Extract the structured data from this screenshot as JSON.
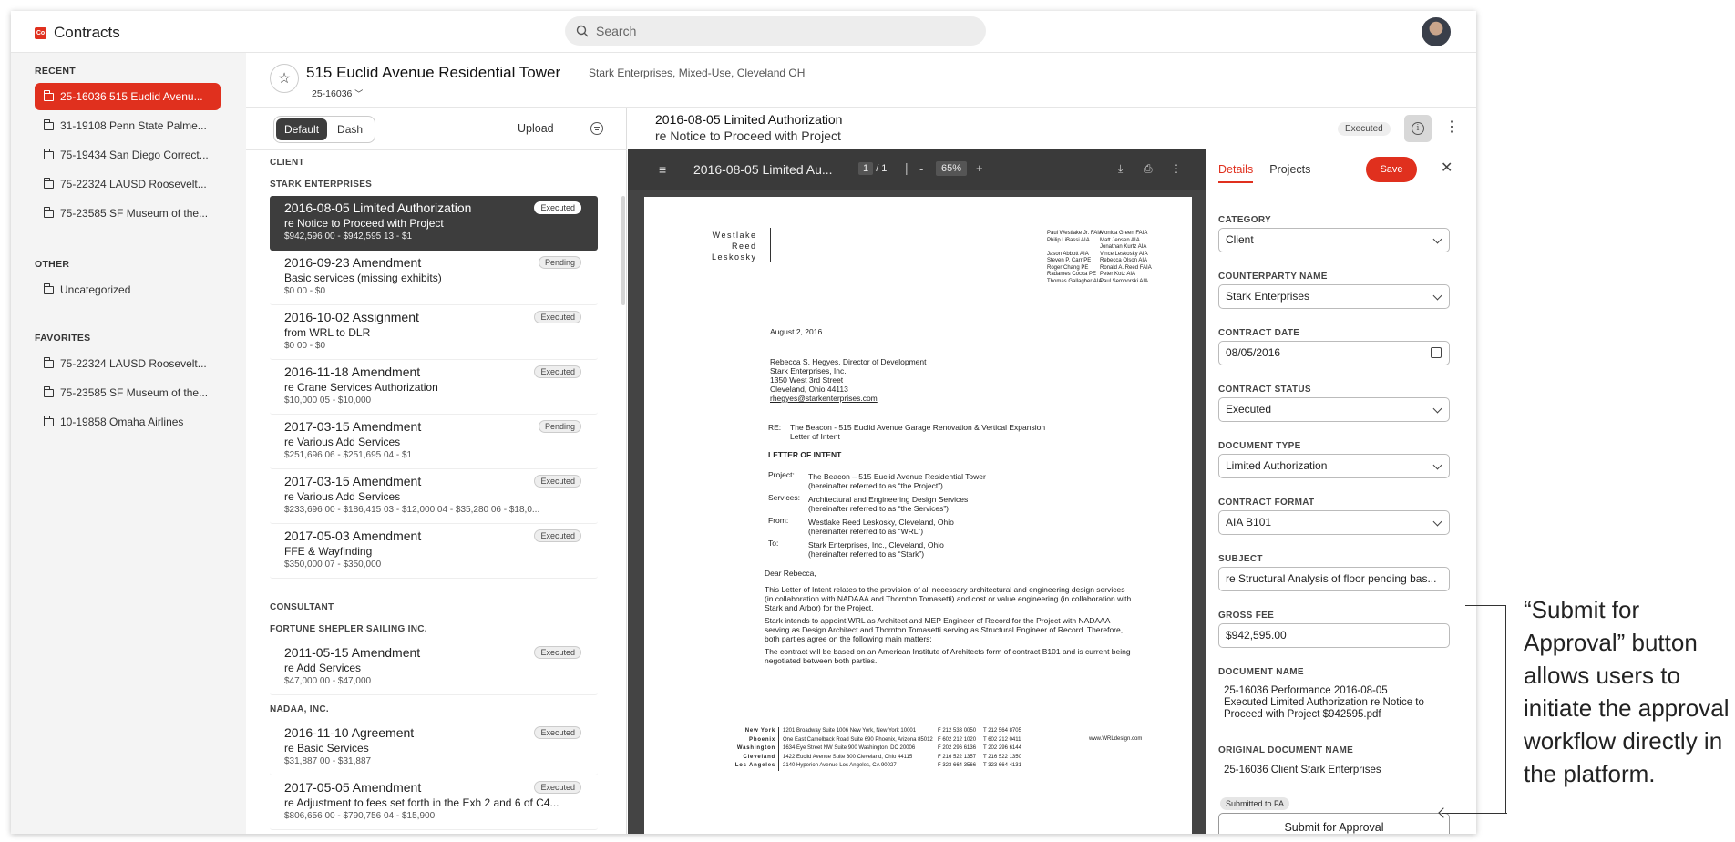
{
  "app": {
    "name": "Contracts",
    "logo_text": "Co"
  },
  "search": {
    "placeholder": "Search"
  },
  "sidebar": {
    "recent_label": "RECENT",
    "recent": [
      {
        "label": "25-16036  515 Euclid Avenu...",
        "active": true
      },
      {
        "label": "31-19108  Penn State Palme..."
      },
      {
        "label": "75-19434  San Diego Correct..."
      },
      {
        "label": "75-22324  LAUSD Roosevelt..."
      },
      {
        "label": "75-23585  SF Museum of the..."
      }
    ],
    "other_label": "OTHER",
    "other": [
      {
        "label": "Uncategorized"
      }
    ],
    "favorites_label": "FAVORITES",
    "favorites": [
      {
        "label": "75-22324  LAUSD Roosevelt..."
      },
      {
        "label": "75-23585  SF Museum of the..."
      },
      {
        "label": "10-19858  Omaha Airlines"
      }
    ]
  },
  "project": {
    "title": "515 Euclid Avenue Residential Tower",
    "subtitle": "Stark Enterprises, Mixed-Use, Cleveland OH",
    "number": "25-16036"
  },
  "list": {
    "view_default": "Default",
    "view_dash": "Dash",
    "upload": "Upload",
    "client_label": "CLIENT",
    "client_org": "STARK ENTERPRISES",
    "client_cards": [
      {
        "title": "2016-08-05 Limited Authorization",
        "sub": "re Notice to Proceed with Project",
        "meta": "$942,596   00 - $942,595   13 - $1",
        "status": "Executed"
      },
      {
        "title": "2016-09-23 Amendment",
        "sub": "Basic services (missing exhibits)",
        "meta": "$0   00 - $0",
        "status": "Pending"
      },
      {
        "title": "2016-10-02 Assignment",
        "sub": "from WRL to DLR",
        "meta": "$0   00 - $0",
        "status": "Executed"
      },
      {
        "title": "2016-11-18 Amendment",
        "sub": "re Crane Services Authorization",
        "meta": "$10,000   05 - $10,000",
        "status": "Executed"
      },
      {
        "title": "2017-03-15 Amendment",
        "sub": "re Various Add Services",
        "meta": "$251,696   06 - $251,695   04 - $1",
        "status": "Pending"
      },
      {
        "title": "2017-03-15 Amendment",
        "sub": "re Various Add Services",
        "meta": "$233,696   00 - $186,415   03 - $12,000   04 - $35,280   06 - $18,0...",
        "status": "Executed"
      },
      {
        "title": "2017-05-03 Amendment",
        "sub": "FFE & Wayfinding",
        "meta": "$350,000   07 - $350,000",
        "status": "Executed"
      }
    ],
    "consultant_label": "CONSULTANT",
    "consultant_org1": "FORTUNE SHEPLER SAILING INC.",
    "consultant_cards1": [
      {
        "title": "2011-05-15 Amendment",
        "sub": "re Add Services",
        "meta": "$47,000   00 - $47,000",
        "status": "Executed"
      }
    ],
    "consultant_org2": "NADAA, INC.",
    "consultant_cards2": [
      {
        "title": "2016-11-10 Agreement",
        "sub": "re Basic Services",
        "meta": "$31,887   00 - $31,887",
        "status": "Executed"
      },
      {
        "title": "2017-05-05 Amendment",
        "sub": "re Adjustment to fees set forth in the Exh 2 and 6 of C4...",
        "meta": "$806,656   00 - $790,756   04 - $15,900",
        "status": "Executed"
      }
    ]
  },
  "viewer": {
    "title": "2016-08-05 Limited Authorization",
    "subtitle": "re Notice to Proceed with Project",
    "status": "Executed",
    "pdf_name": "2016-08-05 Limited Au...",
    "page_current": "1",
    "page_total": "/ 1",
    "zoom": "65%"
  },
  "letter": {
    "logo": [
      "Westlake",
      "Reed",
      "Leskosky"
    ],
    "partners_col1": [
      "Paul Westlake Jr. FAIA",
      "Philip LiBassi AIA",
      "",
      "Jason Abbott AIA",
      "Steven P. Carr PE",
      "Roger Chang PE",
      "Radames Cocca PE",
      "Thomas Gallagher AIA"
    ],
    "partners_col2": [
      "Monica Green FAIA",
      "Matt Jensen AIA",
      "Jonathan Kurtz AIA",
      "Vince Leskosky AIA",
      "Rebecca Olson AIA",
      "Ronald A. Reed FAIA",
      "Peter Kotz AIA",
      "Paul Semborski AIA"
    ],
    "date": "August 2, 2016",
    "address": [
      "Rebecca S. Hegyes, Director of Development",
      "Stark Enterprises, Inc.",
      "1350 West 3rd Street",
      "Cleveland, Ohio  44113",
      "rhegyes@starkenterprises.com"
    ],
    "re_label": "RE:",
    "re_lines": [
      "The Beacon - 515 Euclid Avenue Garage Renovation & Vertical Expansion",
      "Letter of Intent"
    ],
    "heading": "LETTER OF INTENT",
    "project_label": "Project:",
    "project_lines": [
      "The Beacon – 515 Euclid Avenue Residential Tower",
      "(hereinafter referred to as “the Project”)"
    ],
    "services_label": "Services:",
    "services_lines": [
      "Architectural and Engineering Design Services",
      "(hereinafter referred to as “the Services”)"
    ],
    "from_label": "From:",
    "from_lines": [
      "Westlake Reed Leskosky, Cleveland, Ohio",
      "(hereinafter referred to as “WRL”)"
    ],
    "to_label": "To:",
    "to_lines": [
      "Stark Enterprises, Inc., Cleveland, Ohio",
      "(hereinafter referred to as “Stark”)"
    ],
    "salutation": "Dear Rebecca,",
    "para1": [
      "This Letter of Intent relates to the provision of all necessary architectural and engineering design services",
      "(in collaboration with NADAAA and Thornton Tomasetti) and cost or value engineering (in collaboration with",
      "Stark and Arbor) for the Project."
    ],
    "para2": [
      "Stark intends to appoint WRL as Architect and MEP Engineer of Record for the Project with NADAAA",
      "serving as Design Architect and Thornton Tomasetti serving as Structural Engineer of Record.  Therefore,",
      "both parties agree on the following main matters:"
    ],
    "para3": [
      "The contract will be based on an American Institute of Architects form of contract B101 and is current being",
      "negotiated between both parties."
    ],
    "footer_cities": [
      "New York",
      "Phoenix",
      "Washington",
      "Cleveland",
      "Los Angeles"
    ],
    "footer_addr": [
      "1201 Broadway Suite 1006 New York, New York 10001",
      "One East Camelback Road Suite 690 Phoenix, Arizona 85012",
      "1634 Eye Street NW Suite 900 Washington, DC 20006",
      "1422 Euclid Avenue Suite 300 Cleveland, Ohio 44115",
      "2140 Hyperion Avenue Los Angeles, CA 90027"
    ],
    "footer_f": [
      "F 212 533 0050",
      "F 602 212 1020",
      "F 202 296 6136",
      "F 216 522 1357",
      "F 323 664 3566"
    ],
    "footer_t": [
      "T 212 564 8705",
      "T 602 212 0411",
      "T 202 296 6144",
      "T 216 522 1350",
      "T 323 664 4131"
    ],
    "footer_web": "www.WRLdesign.com"
  },
  "details": {
    "tab_details": "Details",
    "tab_projects": "Projects",
    "save": "Save",
    "category_label": "CATEGORY",
    "category": "Client",
    "counterparty_label": "COUNTERPARTY NAME",
    "counterparty": "Stark Enterprises",
    "contract_date_label": "CONTRACT DATE",
    "contract_date": "08/05/2016",
    "status_label": "CONTRACT STATUS",
    "status": "Executed",
    "doc_type_label": "DOCUMENT TYPE",
    "doc_type": "Limited Authorization",
    "format_label": "CONTRACT FORMAT",
    "format": "AIA B101",
    "subject_label": "SUBJECT",
    "subject": "re Structural Analysis of floor pending bas...",
    "gross_fee_label": "GROSS FEE",
    "gross_fee": "$942,595.00",
    "doc_name_label": "DOCUMENT NAME",
    "doc_name": [
      "25-16036 Performance 2016-08-05",
      "Executed Limited Authorization re Notice to",
      "Proceed with Project $942595.pdf"
    ],
    "orig_doc_name_label": "ORIGINAL DOCUMENT NAME",
    "orig_doc_name": "25-16036 Client Stark Enterprises",
    "fa_badge": "Submitted to FA",
    "submit": "Submit for Approval"
  },
  "annotation": {
    "text": "“Submit for Approval” button allows users to initiate the approval workflow directly in the platform."
  },
  "colors": {
    "accent": "#e0301e",
    "dark_card": "#3d3d3d",
    "viewer_bg": "#444444"
  }
}
